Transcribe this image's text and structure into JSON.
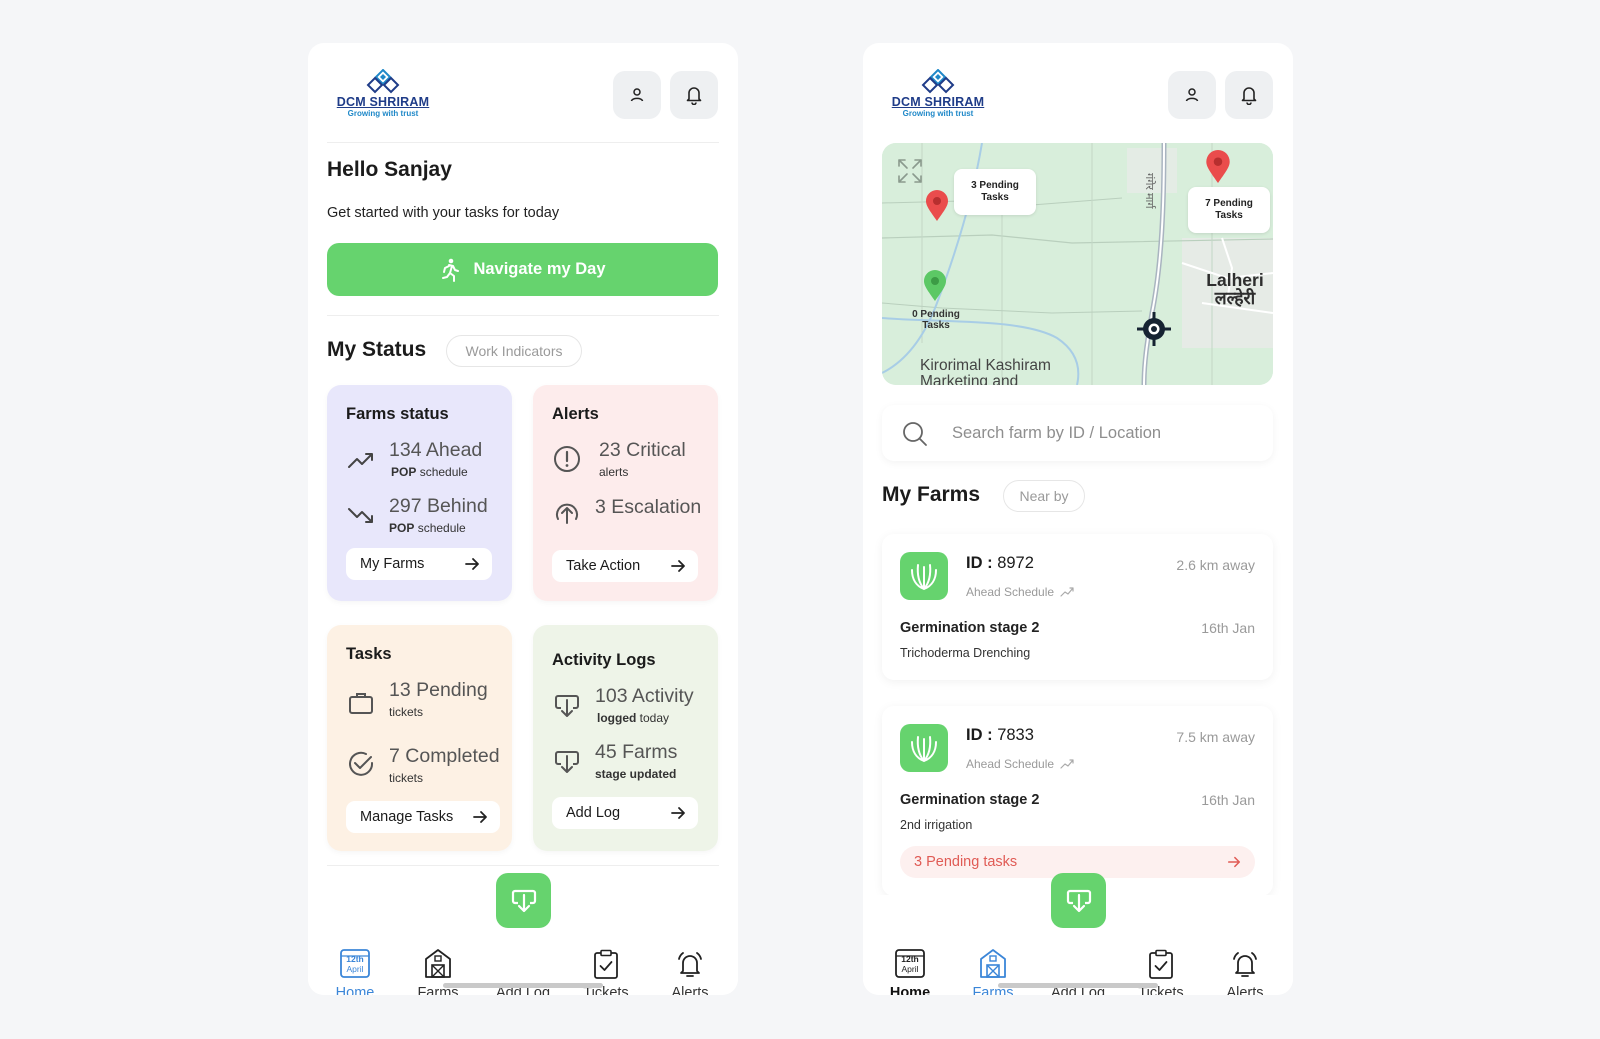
{
  "brand": {
    "name": "DCM SHRIRAM",
    "tagline": "Growing with trust",
    "logo_icon": "diamond-logo-icon"
  },
  "colors": {
    "accent_green": "#66d36e",
    "active_blue": "#3b86d8",
    "alert_red": "#e05b55",
    "farms_card": "#e8e7fb",
    "alerts_card": "#fdecec",
    "tasks_card": "#fdf1e4",
    "logs_card": "#eef4e8"
  },
  "home": {
    "greeting": "Hello Sanjay",
    "subtitle": "Get started with your tasks for today",
    "navigate_button": "Navigate my Day",
    "status_title": "My Status",
    "status_chip": "Work Indicators",
    "cards": {
      "farms": {
        "title": "Farms status",
        "ahead_num": "134 Ahead",
        "ahead_sub_bold": "POP",
        "ahead_sub": "schedule",
        "behind_num": "297 Behind",
        "behind_sub_bold": "POP",
        "behind_sub": "schedule",
        "button": "My Farms"
      },
      "alerts": {
        "title": "Alerts",
        "critical_num": "23 Critical",
        "critical_sub": "alerts",
        "escalation_num": "3 Escalation",
        "button": "Take Action"
      },
      "tasks": {
        "title": "Tasks",
        "pending_num": "13 Pending",
        "pending_sub": "tickets",
        "completed_num": "7 Completed",
        "completed_sub": "tickets",
        "button": "Manage Tasks"
      },
      "logs": {
        "title": "Activity Logs",
        "activity_num": "103 Activity",
        "activity_sub_bold": "logged",
        "activity_sub": "today",
        "farms_num": "45 Farms",
        "farms_sub": "stage updated",
        "button": "Add Log"
      }
    }
  },
  "nav": {
    "calendar_day": "12th",
    "calendar_month": "April",
    "items": [
      "Home",
      "Farms",
      "Add Log",
      "Tickets",
      "Alerts"
    ]
  },
  "farms_screen": {
    "map": {
      "pin1_label_line1": "3 Pending",
      "pin1_label_line2": "Tasks",
      "pin2_label_line1": "7 Pending",
      "pin2_label_line2": "Tasks",
      "pin3_label_line1": "0 Pending",
      "pin3_label_line2": "Tasks",
      "place_en": "Lalheri",
      "place_hi": "लल्हेरी",
      "road_hi": "गंगेर मार्ग",
      "org_line1": "Kirorimal Kashiram",
      "org_line2": "Marketing and"
    },
    "search_placeholder": "Search farm by ID / Location",
    "title": "My Farms",
    "chip": "Near by",
    "farms": [
      {
        "id_label": "ID :",
        "id": "8972",
        "distance": "2.6 km away",
        "schedule": "Ahead Schedule",
        "stage": "Germination stage 2",
        "date": "16th Jan",
        "activity": "Trichoderma Drenching"
      },
      {
        "id_label": "ID :",
        "id": "7833",
        "distance": "7.5 km away",
        "schedule": "Ahead Schedule",
        "stage": "Germination stage 2",
        "date": "16th Jan",
        "activity": "2nd irrigation",
        "pending": "3 Pending tasks"
      }
    ]
  }
}
